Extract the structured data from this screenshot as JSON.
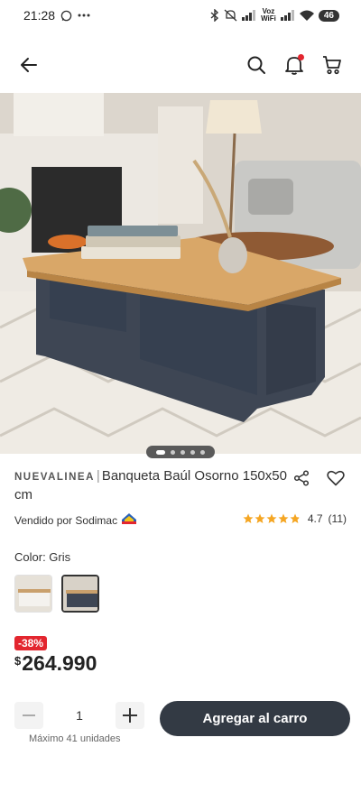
{
  "status_bar": {
    "time": "21:28",
    "volte_top": "Voz",
    "volte_bottom": "WiFi",
    "battery": "46"
  },
  "product": {
    "brand": "NUEVALINEA",
    "separator": "|",
    "title": "Banqueta Baúl Osorno 150x50 cm",
    "seller": "Vendido por Sodimac",
    "rating": "4.7",
    "reviews": "(11)",
    "stars": 4.7,
    "color_label": "Color: Gris",
    "discount": "-38%",
    "currency": "$",
    "price": "264.990",
    "quantity": "1",
    "max_units": "Máximo 41 unidades",
    "add_to_cart": "Agregar al carro",
    "carousel": {
      "count": 5,
      "active": 0
    }
  },
  "colors": {
    "accent_red": "#e3262f",
    "button_dark": "#333a44",
    "star": "#f5a623"
  }
}
